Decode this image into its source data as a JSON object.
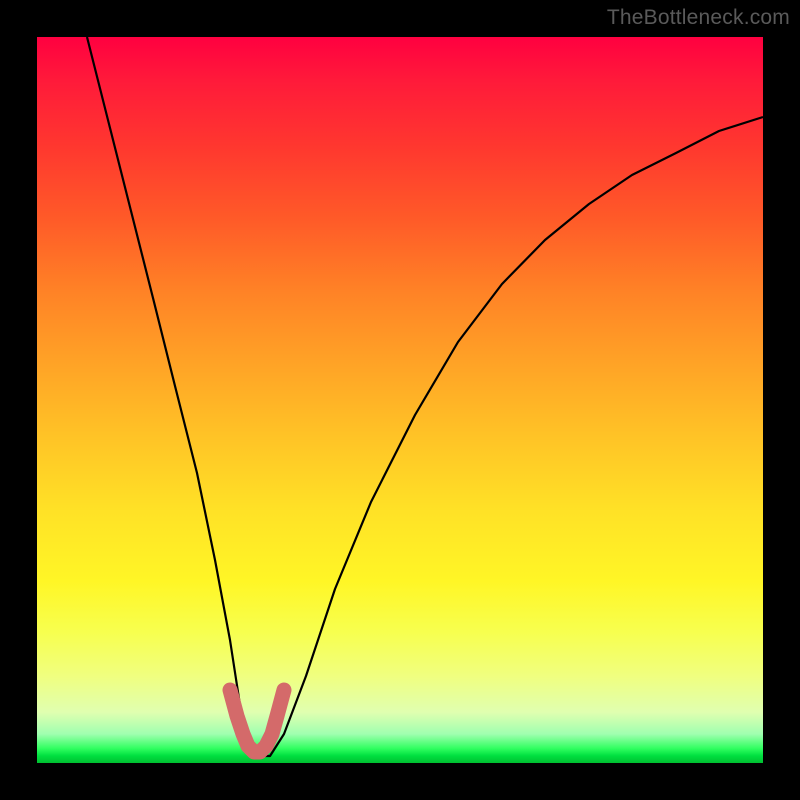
{
  "watermark": "TheBottleneck.com",
  "chart_data": {
    "type": "line",
    "title": "",
    "xlabel": "",
    "ylabel": "",
    "xlim": [
      0,
      100
    ],
    "ylim": [
      0,
      100
    ],
    "series": [
      {
        "name": "curve",
        "x": [
          7,
          10,
          13,
          16,
          19,
          22,
          24.5,
          26.5,
          28,
          29.3,
          30.5,
          32,
          34,
          37,
          41,
          46,
          52,
          58,
          64,
          70,
          76,
          82,
          88,
          94,
          100
        ],
        "y": [
          100,
          88,
          76,
          64,
          52,
          40,
          28,
          17,
          8,
          3,
          1,
          1,
          4,
          12,
          24,
          36,
          48,
          58,
          66,
          72,
          77,
          81,
          84,
          87,
          89
        ]
      },
      {
        "name": "trough-marker",
        "x": [
          26.5,
          27.5,
          28.3,
          29.1,
          29.9,
          30.7,
          31.5,
          32.3,
          33.1,
          34.0
        ],
        "y": [
          10.0,
          6.5,
          4.0,
          2.3,
          1.5,
          1.5,
          2.3,
          4.0,
          6.5,
          10.0
        ]
      }
    ],
    "colors": {
      "curve": "#000000",
      "trough_marker": "#d46a6a",
      "gradient_top": "#ff0040",
      "gradient_bottom": "#00c030"
    }
  }
}
